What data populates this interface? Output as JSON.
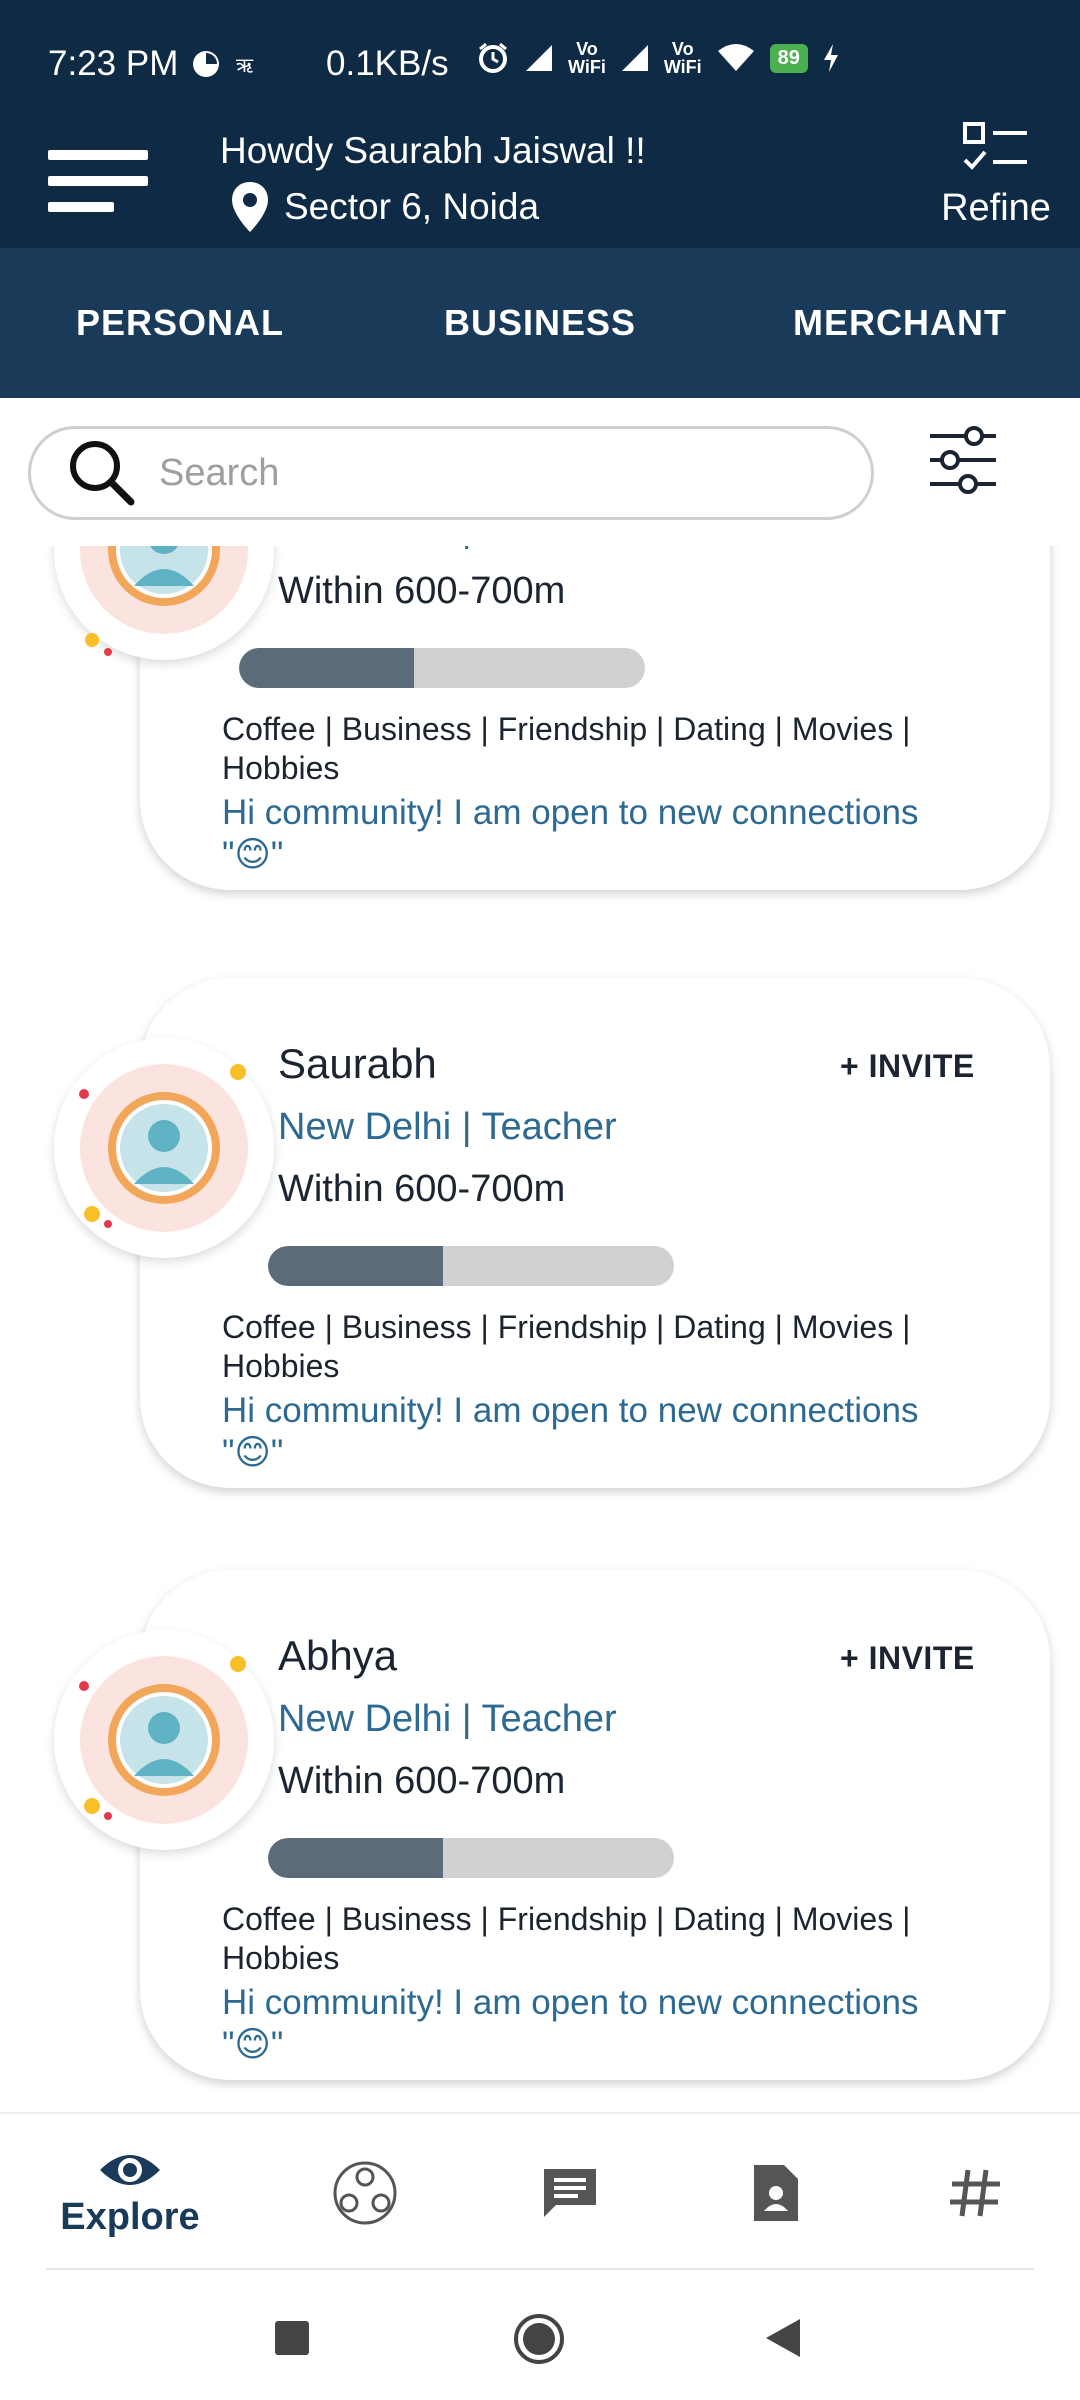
{
  "status_bar": {
    "time": "7:23 PM",
    "net_speed": "0.1KB/s",
    "vowifi_label": "Vo\nWiFi",
    "battery": "89"
  },
  "header": {
    "greeting": "Howdy Saurabh Jaiswal !!",
    "location": "Sector 6, Noida",
    "refine_label": "Refine"
  },
  "tabs": [
    {
      "label": "PERSONAL"
    },
    {
      "label": "BUSINESS"
    },
    {
      "label": "MERCHANT"
    }
  ],
  "search": {
    "placeholder": "Search"
  },
  "profiles": [
    {
      "name": "",
      "role": "New Delhi | Student",
      "distance": "Within 600-700m",
      "match_fraction": 0.43,
      "interests": "Coffee | Business | Friendship | Dating | Movies | Hobbies",
      "bio": "Hi community! I am open to new connections \"😊\"",
      "invite_label": ""
    },
    {
      "name": "Saurabh",
      "role": "New Delhi | Teacher",
      "distance": "Within 600-700m",
      "match_fraction": 0.43,
      "interests": "Coffee | Business | Friendship | Dating | Movies | Hobbies",
      "bio": "Hi community! I am open to new connections \"😊\"",
      "invite_label": "+ INVITE"
    },
    {
      "name": "Abhya",
      "role": "New Delhi | Teacher",
      "distance": "Within 600-700m",
      "match_fraction": 0.43,
      "interests": "Coffee | Business | Friendship | Dating | Movies | Hobbies",
      "bio": "Hi community! I am open to new connections \"😊\"",
      "invite_label": "+ INVITE"
    }
  ],
  "bottom_nav": [
    {
      "label": "Explore",
      "icon": "eye-icon",
      "active": true
    },
    {
      "label": "",
      "icon": "community-icon",
      "active": false
    },
    {
      "label": "",
      "icon": "chat-icon",
      "active": false
    },
    {
      "label": "",
      "icon": "contact-card-icon",
      "active": false
    },
    {
      "label": "",
      "icon": "hashtag-icon",
      "active": false
    }
  ],
  "colors": {
    "header_bg": "#0f2a44",
    "tabs_bg": "#1a3a5a",
    "accent_text": "#2d6a93",
    "bar_fill": "#5b6b7a",
    "bar_track": "#d1d1d1"
  }
}
